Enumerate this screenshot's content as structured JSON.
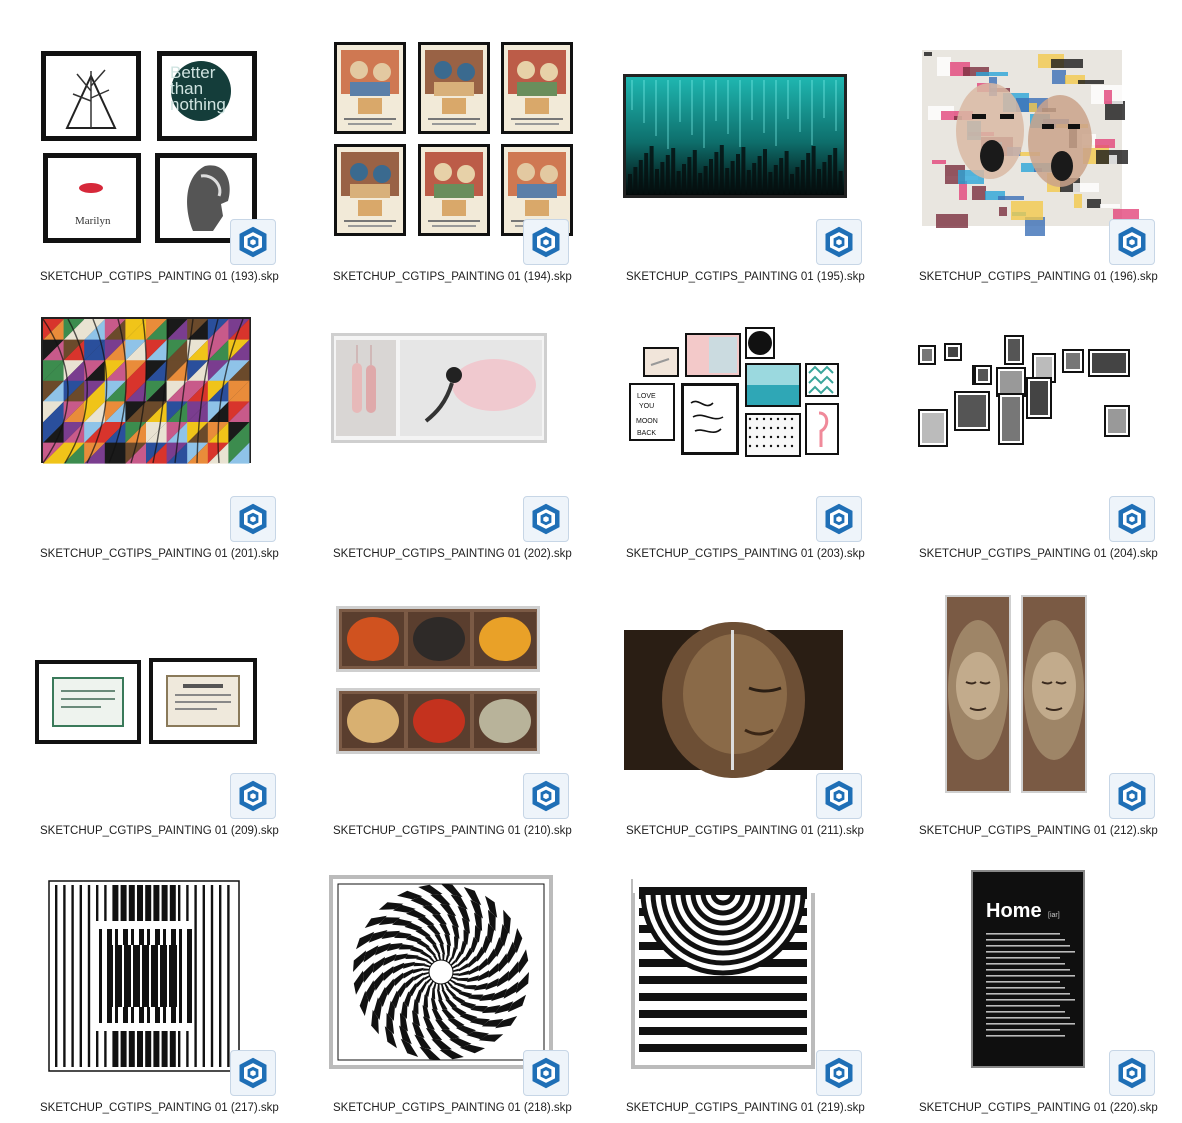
{
  "files": [
    {
      "name": "SKETCHUP_CGTIPS_PAINTING 01 (193).skp",
      "thumb": "mixed-art-prints-2x2",
      "thumb_text": [
        "Better",
        "than",
        "nothing",
        "Marilyn"
      ]
    },
    {
      "name": "SKETCHUP_CGTIPS_PAINTING 01 (194).skp",
      "thumb": "vintage-ads-3x2"
    },
    {
      "name": "SKETCHUP_CGTIPS_PAINTING 01 (195).skp",
      "thumb": "teal-abstract-wide"
    },
    {
      "name": "SKETCHUP_CGTIPS_PAINTING 01 (196).skp",
      "thumb": "graffiti-faces"
    },
    {
      "name": "SKETCHUP_CGTIPS_PAINTING 01 (201).skp",
      "thumb": "colorful-geometric"
    },
    {
      "name": "SKETCHUP_CGTIPS_PAINTING 01 (202).skp",
      "thumb": "ballet-diptych"
    },
    {
      "name": "SKETCHUP_CGTIPS_PAINTING 01 (203).skp",
      "thumb": "gallery-wall-color"
    },
    {
      "name": "SKETCHUP_CGTIPS_PAINTING 01 (204).skp",
      "thumb": "gallery-wall-bw"
    },
    {
      "name": "SKETCHUP_CGTIPS_PAINTING 01 (209).skp",
      "thumb": "certificates"
    },
    {
      "name": "SKETCHUP_CGTIPS_PAINTING 01 (210).skp",
      "thumb": "spices"
    },
    {
      "name": "SKETCHUP_CGTIPS_PAINTING 01 (211).skp",
      "thumb": "buddha-diptych"
    },
    {
      "name": "SKETCHUP_CGTIPS_PAINTING 01 (212).skp",
      "thumb": "buddha-panels"
    },
    {
      "name": "SKETCHUP_CGTIPS_PAINTING 01 (217).skp",
      "thumb": "op-art-stripes"
    },
    {
      "name": "SKETCHUP_CGTIPS_PAINTING 01 (218).skp",
      "thumb": "op-art-spiral"
    },
    {
      "name": "SKETCHUP_CGTIPS_PAINTING 01 (219).skp",
      "thumb": "op-art-arcs"
    },
    {
      "name": "SKETCHUP_CGTIPS_PAINTING 01 (220).skp",
      "thumb": "home-typography",
      "thumb_text": [
        "Home",
        "[iar]"
      ]
    }
  ],
  "badge_icon": "sketchup-logo-icon",
  "colors": {
    "badge_blue": "#1f6fb6",
    "badge_bg": "#eef4fa",
    "text": "#1e1e1e"
  }
}
